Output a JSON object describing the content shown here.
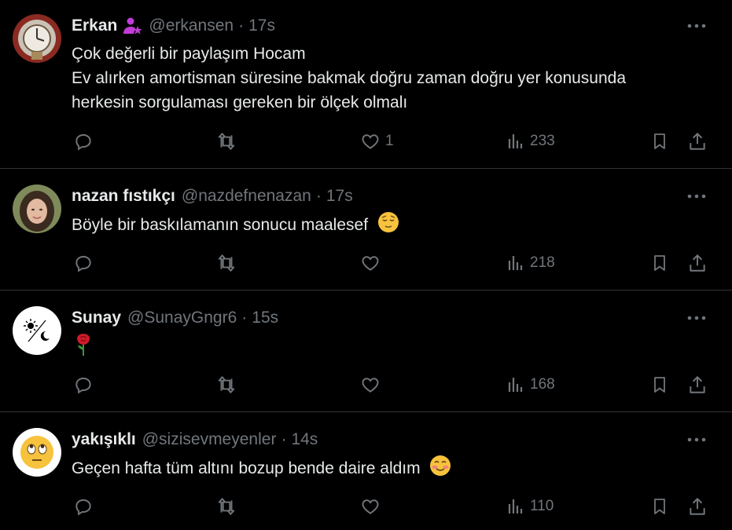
{
  "colors": {
    "background": "#000000",
    "text": "#e7e9ea",
    "muted": "#71767b",
    "divider": "#2f3336",
    "badge": "#c13cd8"
  },
  "tweets": [
    {
      "name": "Erkan",
      "badge_icon": "verified-person-star-icon",
      "handle": "@erkansen",
      "separator": "·",
      "time": "17s",
      "lines": [
        "Çok değerli bir paylaşım Hocam",
        "Ev alırken amortisman süresine bakmak doğru zaman doğru yer konusunda",
        "herkesin sorgulaması gereken bir ölçek olmalı"
      ],
      "likes": "1",
      "views": "233"
    },
    {
      "name": "nazan fıstıkçı",
      "handle": "@nazdefnenazan",
      "separator": "·",
      "time": "17s",
      "lines": [
        "Böyle bir baskılamanın sonucu maalesef"
      ],
      "emoji": "relieved-face-emoji",
      "likes": "",
      "views": "218"
    },
    {
      "name": "Sunay",
      "handle": "@SunayGngr6",
      "separator": "·",
      "time": "15s",
      "lines": [
        ""
      ],
      "emoji": "rose-emoji",
      "likes": "",
      "views": "168"
    },
    {
      "name": "yakışıklı",
      "handle": "@sizisevmeyenler",
      "separator": "·",
      "time": "14s",
      "lines": [
        "Geçen hafta tüm altını bozup bende daire aldım"
      ],
      "emoji": "smiling-face-emoji",
      "likes": "",
      "views": "110"
    }
  ]
}
